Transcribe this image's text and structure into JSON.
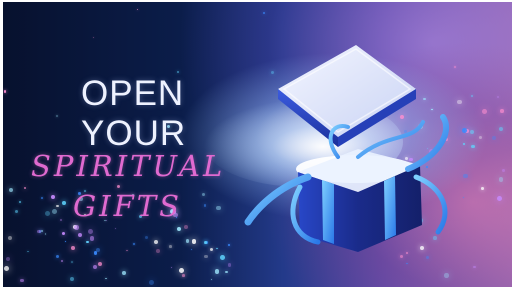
{
  "banner": {
    "line1": "OPEN",
    "line2": "YOUR",
    "line3": "SPIRITUAL",
    "line4": "GIFTS"
  },
  "colors": {
    "headline": "#eef2ff",
    "script": "#e06ad0",
    "box": "#1f3fbf",
    "ribbon": "#3aa0ff"
  }
}
